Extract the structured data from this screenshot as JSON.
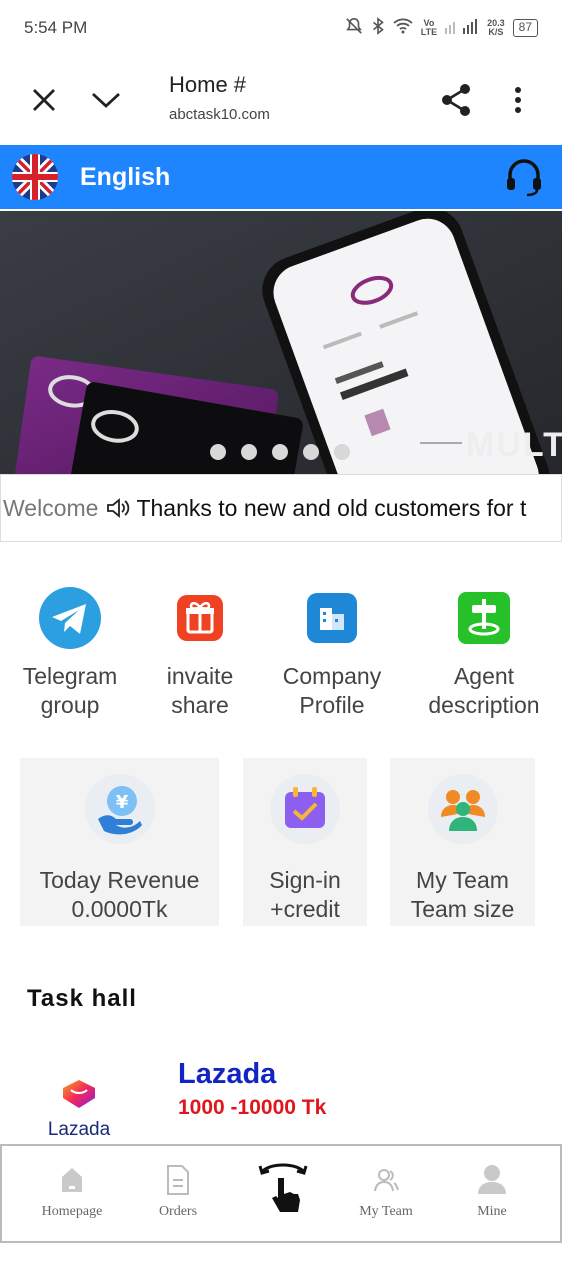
{
  "status_bar": {
    "time": "5:54 PM",
    "lte_top": "Vo",
    "lte_bottom": "LTE",
    "speed_top": "20.3",
    "speed_bottom": "K/S",
    "battery": "87"
  },
  "browser": {
    "title": "Home #",
    "url": "abctask10.com"
  },
  "language_bar": {
    "label": "English",
    "accent": "#1f85ff"
  },
  "banner": {
    "text": "MULTI",
    "slide_count": 5,
    "active_slide": 1
  },
  "notice": {
    "welcome": "Welcome",
    "text": "Thanks to new and old customers for t"
  },
  "quick_links": [
    {
      "label": "Telegram\ngroup",
      "icon": "telegram-icon"
    },
    {
      "label": "invaite\nshare",
      "icon": "gift-icon"
    },
    {
      "label": "Company\nProfile",
      "icon": "building-icon"
    },
    {
      "label": "Agent\ndescription",
      "icon": "signpost-icon"
    }
  ],
  "cards": [
    {
      "line1": "Today Revenue",
      "line2": "0.0000Tk",
      "icon": "yen-hand-icon"
    },
    {
      "line1": "Sign-in",
      "line2": "+credit",
      "icon": "calendar-check-icon"
    },
    {
      "line1": "My Team",
      "line2": "Team size",
      "icon": "team-icon"
    }
  ],
  "task_hall": {
    "heading": "Task hall",
    "items": [
      {
        "logo_text": "Lazada",
        "name": "Lazada",
        "range": "1000 -10000 Tk"
      }
    ]
  },
  "bottom_nav": [
    {
      "label": "Homepage",
      "icon": "home-icon"
    },
    {
      "label": "Orders",
      "icon": "document-icon"
    },
    {
      "label": "",
      "icon": "tap-hand-icon"
    },
    {
      "label": "My Team",
      "icon": "team-outline-icon"
    },
    {
      "label": "Mine",
      "icon": "user-icon"
    }
  ],
  "colors": {
    "task_name": "#1225c4",
    "task_range": "#e0161e"
  }
}
